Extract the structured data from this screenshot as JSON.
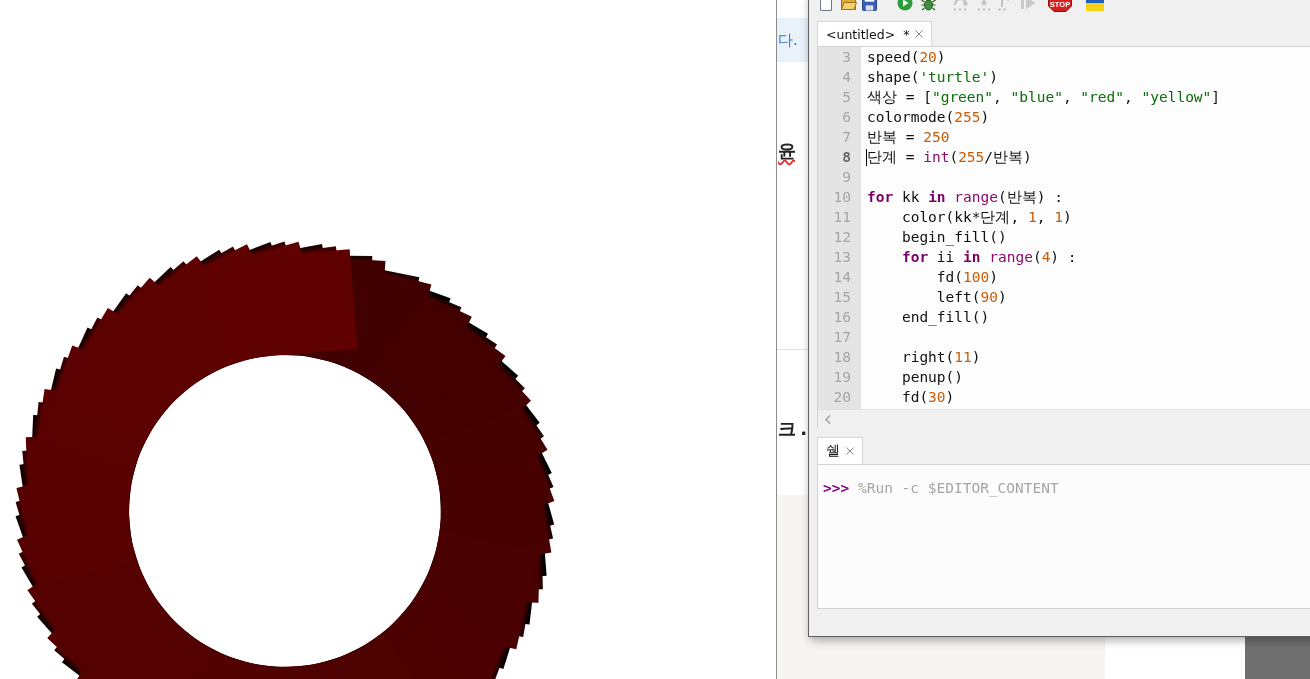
{
  "browser_page": {
    "texts": [
      {
        "kind": "notice",
        "text": "다.",
        "spellcheck_error": false
      },
      {
        "kind": "heading",
        "text": "윤",
        "spellcheck_error": true
      },
      {
        "kind": "heading",
        "text": "크 .",
        "spellcheck_error": false
      }
    ]
  },
  "toolbar": [
    {
      "kind": "new",
      "disabled": false
    },
    {
      "kind": "open",
      "disabled": false
    },
    {
      "kind": "save",
      "disabled": false
    },
    {
      "kind": "run",
      "disabled": false
    },
    {
      "kind": "debug",
      "disabled": false
    },
    {
      "kind": "step_over",
      "disabled": true
    },
    {
      "kind": "step_into",
      "disabled": true
    },
    {
      "kind": "step_out",
      "disabled": true
    },
    {
      "kind": "resume",
      "disabled": true
    },
    {
      "kind": "stop",
      "disabled": false,
      "label": "STOP"
    },
    {
      "kind": "flag",
      "disabled": false
    }
  ],
  "editor": {
    "tabs": [
      {
        "title": "<untitled>",
        "modified_mark": "*",
        "selected": true
      }
    ],
    "lines": [
      {
        "number": "3",
        "current": false,
        "tokens": [
          {
            "kind": "plain",
            "text": "speed("
          },
          {
            "kind": "number",
            "text": "20"
          },
          {
            "kind": "plain",
            "text": ")"
          }
        ]
      },
      {
        "number": "4",
        "current": false,
        "tokens": [
          {
            "kind": "plain",
            "text": "shape("
          },
          {
            "kind": "string",
            "text": "'turtle'"
          },
          {
            "kind": "plain",
            "text": ")"
          }
        ]
      },
      {
        "number": "5",
        "current": false,
        "tokens": [
          {
            "kind": "plain",
            "text": "색상 = ["
          },
          {
            "kind": "string",
            "text": "\"green\""
          },
          {
            "kind": "plain",
            "text": ", "
          },
          {
            "kind": "string",
            "text": "\"blue\""
          },
          {
            "kind": "plain",
            "text": ", "
          },
          {
            "kind": "string",
            "text": "\"red\""
          },
          {
            "kind": "plain",
            "text": ", "
          },
          {
            "kind": "string",
            "text": "\"yellow\""
          },
          {
            "kind": "plain",
            "text": "]"
          }
        ]
      },
      {
        "number": "6",
        "current": false,
        "tokens": [
          {
            "kind": "plain",
            "text": "colormode("
          },
          {
            "kind": "number",
            "text": "255"
          },
          {
            "kind": "plain",
            "text": ")"
          }
        ]
      },
      {
        "number": "7",
        "current": false,
        "tokens": [
          {
            "kind": "plain",
            "text": "반복 = "
          },
          {
            "kind": "number",
            "text": "250"
          }
        ]
      },
      {
        "number": "8",
        "current": true,
        "tokens": [
          {
            "kind": "plain",
            "text": "단계 = "
          },
          {
            "kind": "builtin",
            "text": "int"
          },
          {
            "kind": "plain",
            "text": "("
          },
          {
            "kind": "number",
            "text": "255"
          },
          {
            "kind": "plain",
            "text": "/반복)"
          }
        ]
      },
      {
        "number": "9",
        "current": false
      },
      {
        "number": "10",
        "current": false,
        "tokens": [
          {
            "kind": "keyword",
            "text": "for"
          },
          {
            "kind": "plain",
            "text": " kk "
          },
          {
            "kind": "keyword",
            "text": "in"
          },
          {
            "kind": "builtin",
            "text": " range"
          },
          {
            "kind": "plain",
            "text": "(반복) :"
          }
        ]
      },
      {
        "number": "11",
        "current": false,
        "tokens": [
          {
            "kind": "plain",
            "text": "    color(kk*단계, "
          },
          {
            "kind": "number",
            "text": "1"
          },
          {
            "kind": "plain",
            "text": ", "
          },
          {
            "kind": "number",
            "text": "1"
          },
          {
            "kind": "plain",
            "text": ")"
          }
        ]
      },
      {
        "number": "12",
        "current": false,
        "tokens": [
          {
            "kind": "plain",
            "text": "    begin_fill()"
          }
        ]
      },
      {
        "number": "13",
        "current": false,
        "tokens": [
          {
            "kind": "keyword",
            "text": "    for"
          },
          {
            "kind": "plain",
            "text": " ii "
          },
          {
            "kind": "keyword",
            "text": "in"
          },
          {
            "kind": "builtin",
            "text": " range"
          },
          {
            "kind": "plain",
            "text": "("
          },
          {
            "kind": "number",
            "text": "4"
          },
          {
            "kind": "plain",
            "text": ") :"
          }
        ]
      },
      {
        "number": "14",
        "current": false,
        "tokens": [
          {
            "kind": "plain",
            "text": "        fd("
          },
          {
            "kind": "number",
            "text": "100"
          },
          {
            "kind": "plain",
            "text": ")"
          }
        ]
      },
      {
        "number": "15",
        "current": false,
        "tokens": [
          {
            "kind": "plain",
            "text": "        left("
          },
          {
            "kind": "number",
            "text": "90"
          },
          {
            "kind": "plain",
            "text": ")"
          }
        ]
      },
      {
        "number": "16",
        "current": false,
        "tokens": [
          {
            "kind": "plain",
            "text": "    end_fill()"
          }
        ]
      },
      {
        "number": "17",
        "current": false
      },
      {
        "number": "18",
        "current": false,
        "tokens": [
          {
            "kind": "plain",
            "text": "    right("
          },
          {
            "kind": "number",
            "text": "11"
          },
          {
            "kind": "plain",
            "text": ")"
          }
        ]
      },
      {
        "number": "19",
        "current": false,
        "tokens": [
          {
            "kind": "plain",
            "text": "    penup()"
          }
        ]
      },
      {
        "number": "20",
        "current": false,
        "tokens": [
          {
            "kind": "plain",
            "text": "    fd("
          },
          {
            "kind": "number",
            "text": "30"
          },
          {
            "kind": "plain",
            "text": ")"
          }
        ]
      }
    ]
  },
  "shell": {
    "tabs": [
      {
        "title": "쉘",
        "selected": true
      }
    ],
    "prompt": ">>>",
    "command": "%Run -c $EDITOR_CONTENT"
  }
}
